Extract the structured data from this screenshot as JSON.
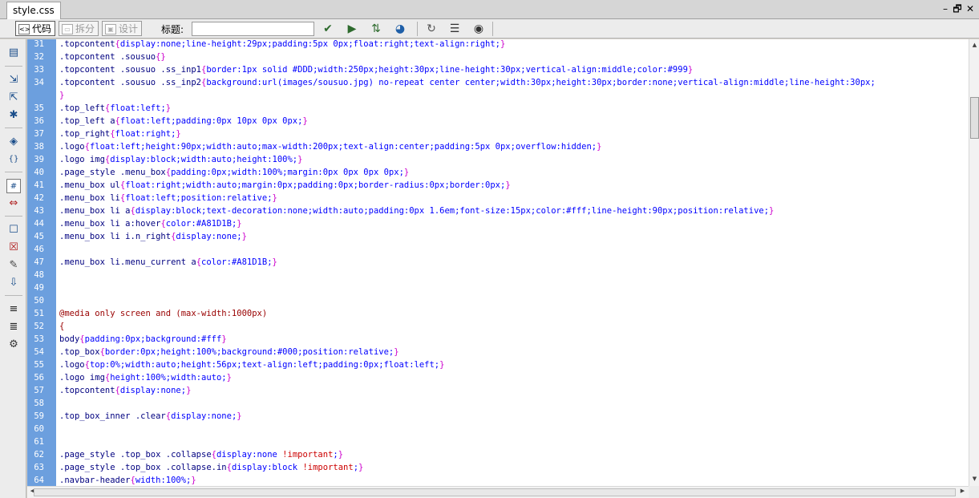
{
  "tab": {
    "label": "style.css"
  },
  "window_controls": {
    "minimize": "–",
    "restore": "🗗",
    "close": "✕"
  },
  "toolbar": {
    "views": [
      {
        "glyph": "<>",
        "label": "代码"
      },
      {
        "glyph": "▭",
        "label": "拆分"
      },
      {
        "glyph": "▣",
        "label": "设计"
      }
    ],
    "title_label": "标题:",
    "title_value": "",
    "icons": [
      "validate-icon",
      "debug-icon",
      "file-transfer-icon",
      "browser-preview-icon",
      "refresh-icon",
      "view-options-icon",
      "visual-aids-icon"
    ],
    "icon_glyphs": [
      "✔",
      "▶",
      "⇅",
      "◕",
      "↻",
      "☰",
      "◉"
    ]
  },
  "left_tools": {
    "glyphs": [
      "▤",
      "⇲",
      "⇱",
      "✱",
      "◈",
      "{}",
      "#",
      "⇔",
      "☐",
      "☒",
      "✎",
      "⇩",
      "≡",
      "≣",
      "⚙"
    ]
  },
  "lines": [
    {
      "n": "31",
      "t": [
        [
          ".topcontent",
          "sel"
        ],
        [
          "{",
          "brace"
        ],
        [
          "display:none;line-height:29px;padding:5px 0px;float:right;text-align:right;",
          "body"
        ],
        [
          "}",
          "brace"
        ]
      ]
    },
    {
      "n": "32",
      "t": [
        [
          ".topcontent .sousuo",
          "sel"
        ],
        [
          "{}",
          "brace"
        ]
      ]
    },
    {
      "n": "33",
      "t": [
        [
          ".topcontent .sousuo .ss_inp1",
          "sel"
        ],
        [
          "{",
          "brace"
        ],
        [
          "border:1px solid #DDD;width:250px;height:30px;line-height:30px;vertical-align:middle;color:#999",
          "body"
        ],
        [
          "}",
          "brace"
        ]
      ]
    },
    {
      "n": "34",
      "t": [
        [
          ".topcontent .sousuo .ss_inp2",
          "sel"
        ],
        [
          "{",
          "brace"
        ],
        [
          "background:url(images/sousuo.jpg) no-repeat center center;width:30px;height:30px;border:none;vertical-align:middle;line-height:30px;",
          "body"
        ]
      ]
    },
    {
      "n": "",
      "t": [
        [
          "}",
          "brace"
        ]
      ]
    },
    {
      "n": "35",
      "t": [
        [
          ".top_left",
          "sel"
        ],
        [
          "{",
          "brace"
        ],
        [
          "float:left;",
          "body"
        ],
        [
          "}",
          "brace"
        ]
      ]
    },
    {
      "n": "36",
      "t": [
        [
          ".top_left a",
          "sel"
        ],
        [
          "{",
          "brace"
        ],
        [
          "float:left;padding:0px 10px 0px 0px;",
          "body"
        ],
        [
          "}",
          "brace"
        ]
      ]
    },
    {
      "n": "37",
      "t": [
        [
          ".top_right",
          "sel"
        ],
        [
          "{",
          "brace"
        ],
        [
          "float:right;",
          "body"
        ],
        [
          "}",
          "brace"
        ]
      ]
    },
    {
      "n": "38",
      "t": [
        [
          ".logo",
          "sel"
        ],
        [
          "{",
          "brace"
        ],
        [
          "float:left;height:90px;width:auto;max-width:200px;text-align:center;padding:5px 0px;overflow:hidden;",
          "body"
        ],
        [
          "}",
          "brace"
        ]
      ]
    },
    {
      "n": "39",
      "t": [
        [
          ".logo img",
          "sel"
        ],
        [
          "{",
          "brace"
        ],
        [
          "display:block;width:auto;height:100%;",
          "body"
        ],
        [
          "}",
          "brace"
        ]
      ]
    },
    {
      "n": "40",
      "t": [
        [
          ".page_style .menu_box",
          "sel"
        ],
        [
          "{",
          "brace"
        ],
        [
          "padding:0px;width:100%;margin:0px 0px 0px 0px;",
          "body"
        ],
        [
          "}",
          "brace"
        ]
      ]
    },
    {
      "n": "41",
      "t": [
        [
          ".menu_box ul",
          "sel"
        ],
        [
          "{",
          "brace"
        ],
        [
          "float:right;width:auto;margin:0px;padding:0px;border-radius:0px;border:0px;",
          "body"
        ],
        [
          "}",
          "brace"
        ]
      ]
    },
    {
      "n": "42",
      "t": [
        [
          ".menu_box li",
          "sel"
        ],
        [
          "{",
          "brace"
        ],
        [
          "float:left;position:relative;",
          "body"
        ],
        [
          "}",
          "brace"
        ]
      ]
    },
    {
      "n": "43",
      "t": [
        [
          ".menu_box li a",
          "sel"
        ],
        [
          "{",
          "brace"
        ],
        [
          "display:block;text-decoration:none;width:auto;padding:0px 1.6em;font-size:15px;color:#fff;line-height:90px;position:relative;",
          "body"
        ],
        [
          "}",
          "brace"
        ]
      ]
    },
    {
      "n": "44",
      "t": [
        [
          ".menu_box li a:hover",
          "sel"
        ],
        [
          "{",
          "brace"
        ],
        [
          "color:#A81D1B;",
          "body"
        ],
        [
          "}",
          "brace"
        ]
      ]
    },
    {
      "n": "45",
      "t": [
        [
          ".menu_box li i.n_right",
          "sel"
        ],
        [
          "{",
          "brace"
        ],
        [
          "display:none;",
          "body"
        ],
        [
          "}",
          "brace"
        ]
      ]
    },
    {
      "n": "46",
      "t": []
    },
    {
      "n": "47",
      "t": [
        [
          ".menu_box li.menu_current a",
          "sel"
        ],
        [
          "{",
          "brace"
        ],
        [
          "color:#A81D1B;",
          "body"
        ],
        [
          "}",
          "brace"
        ]
      ]
    },
    {
      "n": "48",
      "t": []
    },
    {
      "n": "49",
      "t": []
    },
    {
      "n": "50",
      "t": []
    },
    {
      "n": "51",
      "t": [
        [
          "@media only screen and (max-width:1000px)",
          "media"
        ]
      ]
    },
    {
      "n": "52",
      "t": [
        [
          "{",
          "media"
        ]
      ]
    },
    {
      "n": "53",
      "t": [
        [
          "body",
          "sel"
        ],
        [
          "{",
          "brace"
        ],
        [
          "padding:0px;background:#fff",
          "body"
        ],
        [
          "}",
          "brace"
        ]
      ]
    },
    {
      "n": "54",
      "t": [
        [
          ".top_box",
          "sel"
        ],
        [
          "{",
          "brace"
        ],
        [
          "border:0px;height:100%;background:#000;position:relative;",
          "body"
        ],
        [
          "}",
          "brace"
        ]
      ]
    },
    {
      "n": "55",
      "t": [
        [
          ".logo",
          "sel"
        ],
        [
          "{",
          "brace"
        ],
        [
          "top:0%;width:auto;height:56px;text-align:left;padding:0px;float:left;",
          "body"
        ],
        [
          "}",
          "brace"
        ]
      ]
    },
    {
      "n": "56",
      "t": [
        [
          ".logo img",
          "sel"
        ],
        [
          "{",
          "brace"
        ],
        [
          "height:100%;width:auto;",
          "body"
        ],
        [
          "}",
          "brace"
        ]
      ]
    },
    {
      "n": "57",
      "t": [
        [
          ".topcontent",
          "sel"
        ],
        [
          "{",
          "brace"
        ],
        [
          "display:none;",
          "body"
        ],
        [
          "}",
          "brace"
        ]
      ]
    },
    {
      "n": "58",
      "t": []
    },
    {
      "n": "59",
      "t": [
        [
          ".top_box_inner .clear",
          "sel"
        ],
        [
          "{",
          "brace"
        ],
        [
          "display:none;",
          "body"
        ],
        [
          "}",
          "brace"
        ]
      ]
    },
    {
      "n": "60",
      "t": []
    },
    {
      "n": "61",
      "t": []
    },
    {
      "n": "62",
      "t": [
        [
          ".page_style .top_box .collapse",
          "sel"
        ],
        [
          "{",
          "brace"
        ],
        [
          "display:none ",
          "body"
        ],
        [
          "!important",
          "imp"
        ],
        [
          ";",
          "body"
        ],
        [
          "}",
          "brace"
        ]
      ]
    },
    {
      "n": "63",
      "t": [
        [
          ".page_style .top_box .collapse.in",
          "sel"
        ],
        [
          "{",
          "brace"
        ],
        [
          "display:block ",
          "body"
        ],
        [
          "!important",
          "imp"
        ],
        [
          ";",
          "body"
        ],
        [
          "}",
          "brace"
        ]
      ]
    },
    {
      "n": "64",
      "t": [
        [
          ".navbar-header",
          "sel"
        ],
        [
          "{",
          "brace"
        ],
        [
          "width:100%;",
          "body"
        ],
        [
          "}",
          "brace"
        ]
      ]
    }
  ]
}
